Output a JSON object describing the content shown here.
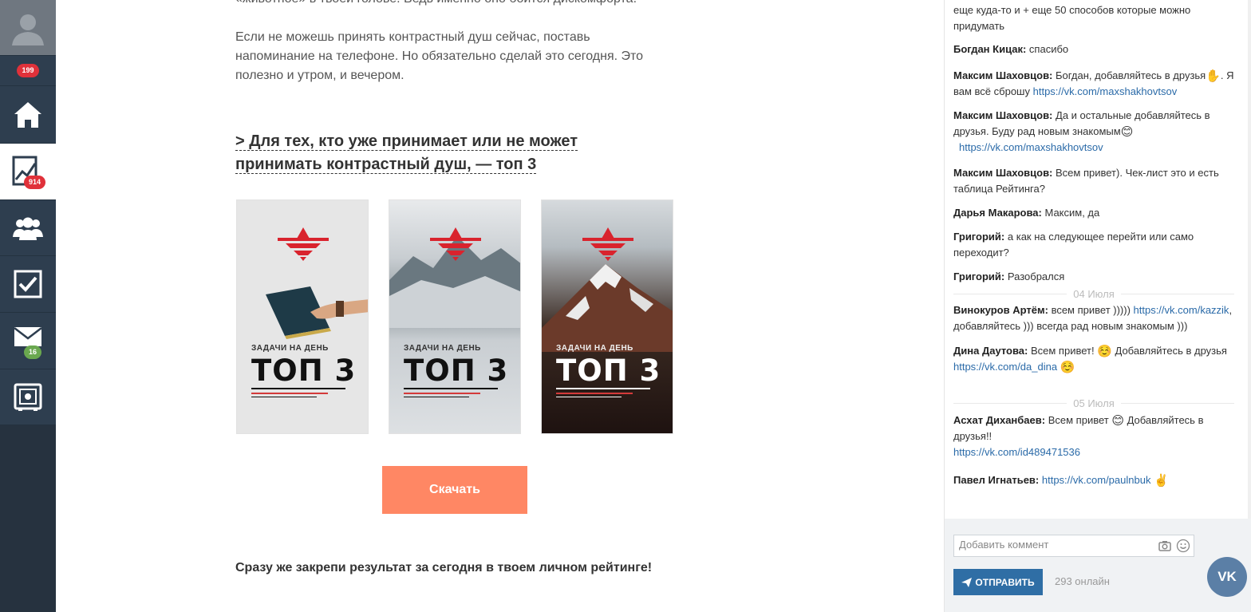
{
  "sidebar": {
    "profile_count": "199",
    "rating_count": "914",
    "mail_count": "16"
  },
  "article": {
    "prev_text_cut": "«животное» в твоей голове. Ведь именно оно боится дискомфорта.",
    "paragraph": "Если не можешь принять контрастный душ сейчас, поставь напоминание на телефоне. Но обязательно сделай это сегодня. Это полезно и утром, и вечером.",
    "heading": "> Для тех, кто уже принимает или не может принимать контрастный душ, — топ 3",
    "cards": [
      {
        "subtitle": "ЗАДАЧИ НА ДЕНЬ",
        "title": "ТОП 3"
      },
      {
        "subtitle": "ЗАДАЧИ НА ДЕНЬ",
        "title": "ТОП 3"
      },
      {
        "subtitle": "ЗАДАЧИ НА ДЕНЬ",
        "title": "ТОП 3"
      }
    ],
    "download_label": "Скачать",
    "bottom_text": "Сразу же закрепи результат за сегодня в твоем личном рейтинге!"
  },
  "chat": {
    "messages": [
      {
        "author": "",
        "text": "еще куда-то и + еще 50 способов которые можно придумать"
      },
      {
        "author": "Богдан Кицак:",
        "text": "спасибо"
      },
      {
        "author": "Максим Шаховцов:",
        "text": "Богдан, добавляйтесь в друзья",
        "emoji": "✋",
        "text2": ". Я вам всё сброшу",
        "link": "https://vk.com/maxshakhovtsov"
      },
      {
        "author": "Максим Шаховцов:",
        "text": "Да и остальные добавляйтесь в друзья. Буду рад новым знакомым",
        "emoji": "😊",
        "link": "https://vk.com/maxshakhovtsov"
      },
      {
        "author": "Максим Шаховцов:",
        "text": "Всем привет). Чек-лист это и есть таблица Рейтинга?"
      },
      {
        "author": "Дарья Макарова:",
        "text": "Максим, да"
      },
      {
        "author": "Григорий:",
        "text": "а как на следующее перейти или само переходит?"
      },
      {
        "author": "Григорий:",
        "text": "Разобрался"
      },
      {
        "author": "Винокуров Артём:",
        "text": "всем привет ))))) ",
        "link": "https://vk.com/kazzik",
        "text2": ", добавляйтесь ))) всегда рад новым знакомым )))"
      },
      {
        "author": "Дина Даутова:",
        "text": "Всем привет!",
        "emoji": "☺️",
        "text2": " Добавляйтесь в друзья",
        "link": "https://vk.com/da_dina",
        "emoji2": "☺️"
      },
      {
        "author": "Асхат Диханбаев:",
        "text": "Всем привет",
        "emoji": "😊",
        "text2": " Добавляйтесь в друзья!!",
        "link": "https://vk.com/id489471536"
      },
      {
        "author": "Павел Игнатьев:",
        "link": "https://vk.com/paulnbuk",
        "emoji": "✌️"
      }
    ],
    "date_seps": [
      "04 Июля",
      "05 Июля"
    ],
    "comment_placeholder": "Добавить коммент",
    "send_label": "ОТПРАВИТЬ",
    "online": "293 онлайн",
    "vk_label": "VK"
  },
  "colors": {
    "sidebar": "#2e3e4f",
    "accent_btn": "#ff8764",
    "send_btn": "#2f6ea5",
    "badge_red": "#e0313a",
    "badge_green": "#6aa84f",
    "link": "#2a6aa8"
  }
}
